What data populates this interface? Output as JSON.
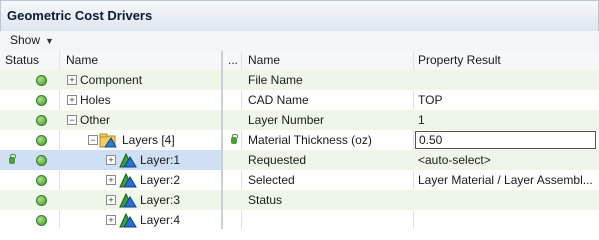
{
  "title": "Geometric Cost Drivers",
  "toolbar": {
    "show_label": "Show"
  },
  "left": {
    "headers": {
      "status": "Status",
      "name": "Name"
    },
    "rows": [
      {
        "name": "Component",
        "expander": "+"
      },
      {
        "name": "Holes",
        "expander": "+"
      },
      {
        "name": "Other",
        "expander": "−"
      },
      {
        "name": "Layers [4]",
        "expander": "−"
      },
      {
        "name": "Layer:1",
        "expander": "+"
      },
      {
        "name": "Layer:2",
        "expander": "+"
      },
      {
        "name": "Layer:3",
        "expander": "+"
      },
      {
        "name": "Layer:4",
        "expander": "+"
      }
    ]
  },
  "right": {
    "headers": {
      "dots": "...",
      "name": "Name",
      "result": "Property Result"
    },
    "rows": [
      {
        "name": "File Name",
        "result": ""
      },
      {
        "name": "CAD Name",
        "result": "TOP"
      },
      {
        "name": "Layer Number",
        "result": "1"
      },
      {
        "name": "Material Thickness (oz)",
        "result": "0.50"
      },
      {
        "name": "Requested",
        "result": "<auto-select>"
      },
      {
        "name": "Selected",
        "result": "Layer Material / Layer Assembl..."
      },
      {
        "name": "Status",
        "result": ""
      }
    ]
  }
}
